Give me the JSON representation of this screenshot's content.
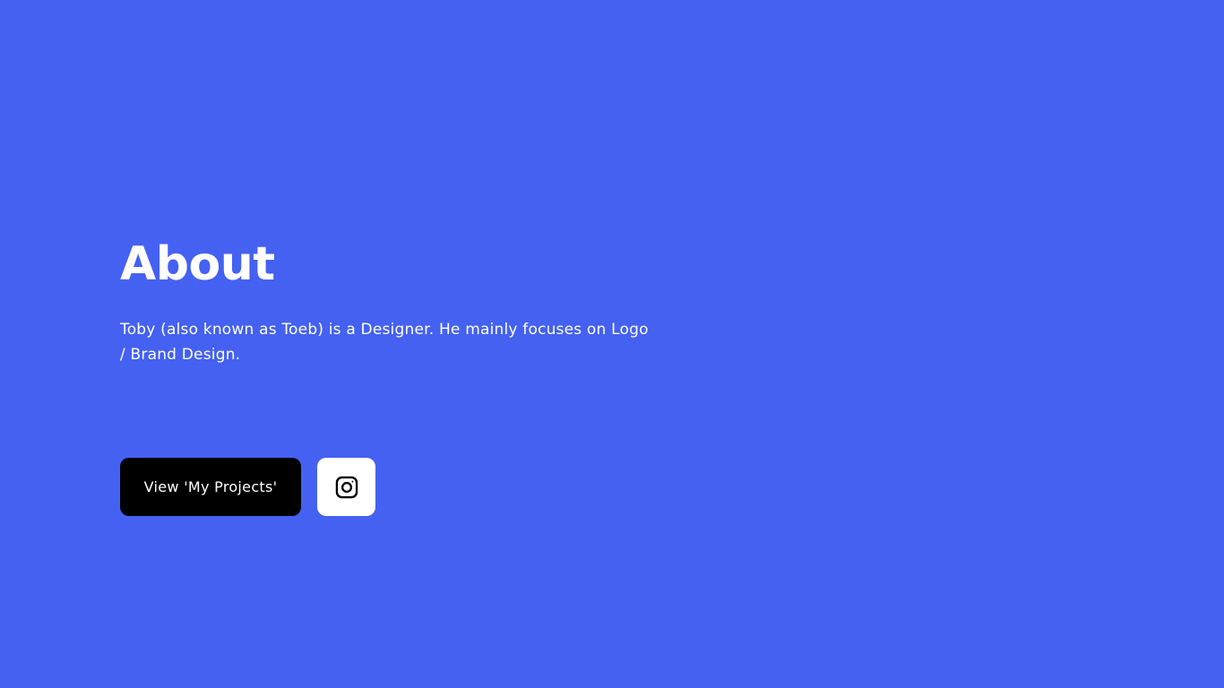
{
  "about": {
    "title": "About",
    "description": "Toby (also known as Toeb) is a Designer. He mainly focuses on Logo / Brand Design."
  },
  "actions": {
    "projects_button_label": "View 'My Projects'",
    "instagram_icon": "instagram-icon"
  },
  "colors": {
    "background": "#4461f2",
    "primary_button": "#000000",
    "secondary_button": "#ffffff",
    "text": "#ffffff"
  }
}
